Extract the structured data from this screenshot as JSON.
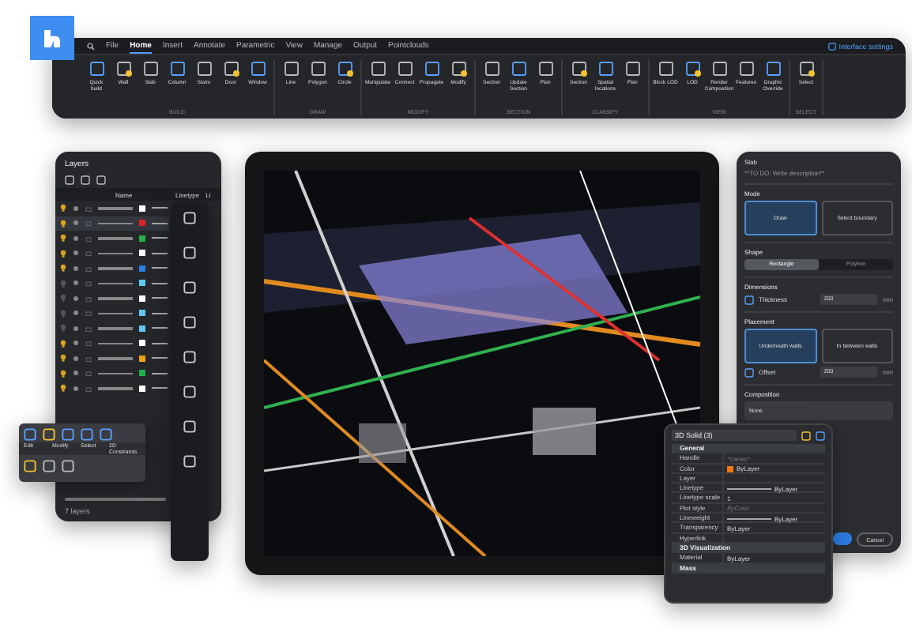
{
  "ribbon": {
    "menu": [
      {
        "label": "File",
        "selected": false
      },
      {
        "label": "Home",
        "selected": true
      },
      {
        "label": "Insert",
        "selected": false
      },
      {
        "label": "Annotate",
        "selected": false
      },
      {
        "label": "Parametric",
        "selected": false
      },
      {
        "label": "View",
        "selected": false
      },
      {
        "label": "Manage",
        "selected": false
      },
      {
        "label": "Output",
        "selected": false
      },
      {
        "label": "Pointclouds",
        "selected": false
      }
    ],
    "settings_link": "Interface settings",
    "groups": [
      {
        "label": "BUILD",
        "tools": [
          "Quick build",
          "Wall",
          "Slab",
          "Column",
          "Stairs",
          "Door",
          "Window"
        ]
      },
      {
        "label": "DRAW",
        "tools": [
          "Line",
          "Polygon",
          "Circle"
        ]
      },
      {
        "label": "MODIFY",
        "tools": [
          "Manipulate",
          "Connect",
          "Propagate",
          "Modify"
        ]
      },
      {
        "label": "SECTION",
        "tools": [
          "Section",
          "Update Section",
          "Plan"
        ]
      },
      {
        "label": "CLASSIFY",
        "tools": [
          "Section",
          "Spatial locations",
          "Plan"
        ]
      },
      {
        "label": "VIEW",
        "tools": [
          "Block LOD",
          "LOD",
          "Render Composition",
          "Features",
          "Graphic Override"
        ]
      },
      {
        "label": "SELECT",
        "tools": [
          "Select"
        ]
      }
    ]
  },
  "layers": {
    "title": "Layers",
    "columns": [
      "Name",
      "Linetype",
      "Li"
    ],
    "footer": "7 layers",
    "rows": [
      {
        "on": true,
        "selected": false,
        "color": "#ffffff"
      },
      {
        "on": true,
        "selected": true,
        "color": "#e02020"
      },
      {
        "on": true,
        "selected": false,
        "color": "#22b04b"
      },
      {
        "on": true,
        "selected": false,
        "color": "#ffffff"
      },
      {
        "on": true,
        "selected": false,
        "color": "#2a7fe0"
      },
      {
        "on": false,
        "selected": false,
        "color": "#5cc8f0"
      },
      {
        "on": false,
        "selected": false,
        "color": "#ffffff"
      },
      {
        "on": false,
        "selected": false,
        "color": "#5cc8f0"
      },
      {
        "on": false,
        "selected": false,
        "color": "#5cc8f0"
      },
      {
        "on": true,
        "selected": false,
        "color": "#ffffff"
      },
      {
        "on": true,
        "selected": false,
        "color": "#f0a010"
      },
      {
        "on": true,
        "selected": false,
        "color": "#22b04b"
      },
      {
        "on": true,
        "selected": false,
        "color": "#ffffff"
      }
    ]
  },
  "mini_toolbar": {
    "labels": [
      "Edit",
      "Modify",
      "Select",
      "2D Constraints"
    ]
  },
  "slab_panel": {
    "title": "Slab",
    "description": "**TO DO: Write description**",
    "mode": {
      "label": "Mode",
      "options": [
        {
          "label": "Draw",
          "selected": true
        },
        {
          "label": "Select boundary",
          "selected": false
        }
      ]
    },
    "shape": {
      "label": "Shape",
      "options": [
        {
          "label": "Rectangle",
          "selected": true
        },
        {
          "label": "Polyline",
          "selected": false
        }
      ]
    },
    "dimensions": {
      "label": "Dimensions",
      "field": "Thickness",
      "value": "200",
      "unit": "mm"
    },
    "placement": {
      "label": "Placement",
      "options": [
        {
          "label": "Underneath walls",
          "selected": true
        },
        {
          "label": "In between walls",
          "selected": false
        }
      ],
      "field": "Offset",
      "value": "200",
      "unit": "mm"
    },
    "composition": {
      "label": "Composition",
      "value": "None"
    },
    "cancel": "Cancel"
  },
  "properties": {
    "title": "3D Solid (3)",
    "sections": [
      {
        "label": "General",
        "rows": [
          {
            "name": "Handle",
            "value": "*Varies*",
            "kind": "muted"
          },
          {
            "name": "Color",
            "value": "ByLayer",
            "kind": "swatch"
          },
          {
            "name": "Layer",
            "value": "",
            "kind": "text"
          },
          {
            "name": "Linetype",
            "value": "ByLayer",
            "kind": "line"
          },
          {
            "name": "Linetype scale",
            "value": "1",
            "kind": "text"
          },
          {
            "name": "Plot style",
            "value": "ByColor",
            "kind": "muted"
          },
          {
            "name": "Lineweight",
            "value": "ByLayer",
            "kind": "line"
          },
          {
            "name": "Transparency",
            "value": "ByLayer",
            "kind": "text"
          },
          {
            "name": "Hyperlink",
            "value": "",
            "kind": "text"
          }
        ]
      },
      {
        "label": "3D Visualization",
        "rows": [
          {
            "name": "Material",
            "value": "ByLayer",
            "kind": "text"
          }
        ]
      },
      {
        "label": "Mass"
      }
    ]
  }
}
